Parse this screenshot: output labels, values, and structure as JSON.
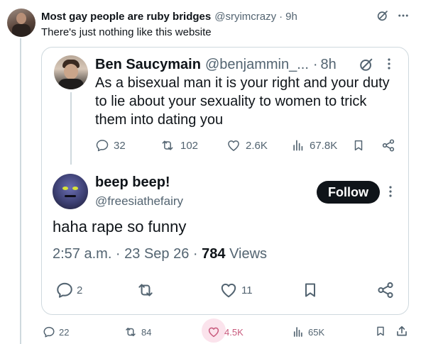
{
  "outer_tweet": {
    "display_name": "Most gay people are ruby bridges",
    "handle": "@sryimcrazy",
    "separator": "·",
    "time": "9h",
    "text": "There's just nothing like this website",
    "actions": {
      "replies": "22",
      "reposts": "84",
      "likes": "4.5K",
      "views": "65K"
    }
  },
  "quoted_tweet": {
    "display_name": "Ben Saucymain",
    "handle": "@benjammin_...",
    "separator": "·",
    "time": "8h",
    "text": "As a bisexual man it is your right and your duty to lie about your sexuality to women to trick them into dating you",
    "actions": {
      "replies": "32",
      "reposts": "102",
      "likes": "2.6K",
      "views": "67.8K"
    }
  },
  "reply_tweet": {
    "display_name": "beep beep!",
    "handle": "@freesiathefairy",
    "follow_label": "Follow",
    "text": "haha rape so funny",
    "timestamp": "2:57 a.m. · 23 Sep 26 ·",
    "view_count": "784",
    "views_label": "Views",
    "actions": {
      "replies": "2",
      "likes": "11"
    }
  },
  "colors": {
    "text_primary": "#0f1419",
    "text_secondary": "#536471",
    "border": "#cfd9de",
    "like_active": "#c85a7d",
    "like_bubble": "#fbe3ec"
  },
  "icons": [
    "grok-icon",
    "more-icon",
    "reply-icon",
    "repost-icon",
    "like-icon",
    "views-icon",
    "bookmark-icon",
    "share-icon"
  ]
}
